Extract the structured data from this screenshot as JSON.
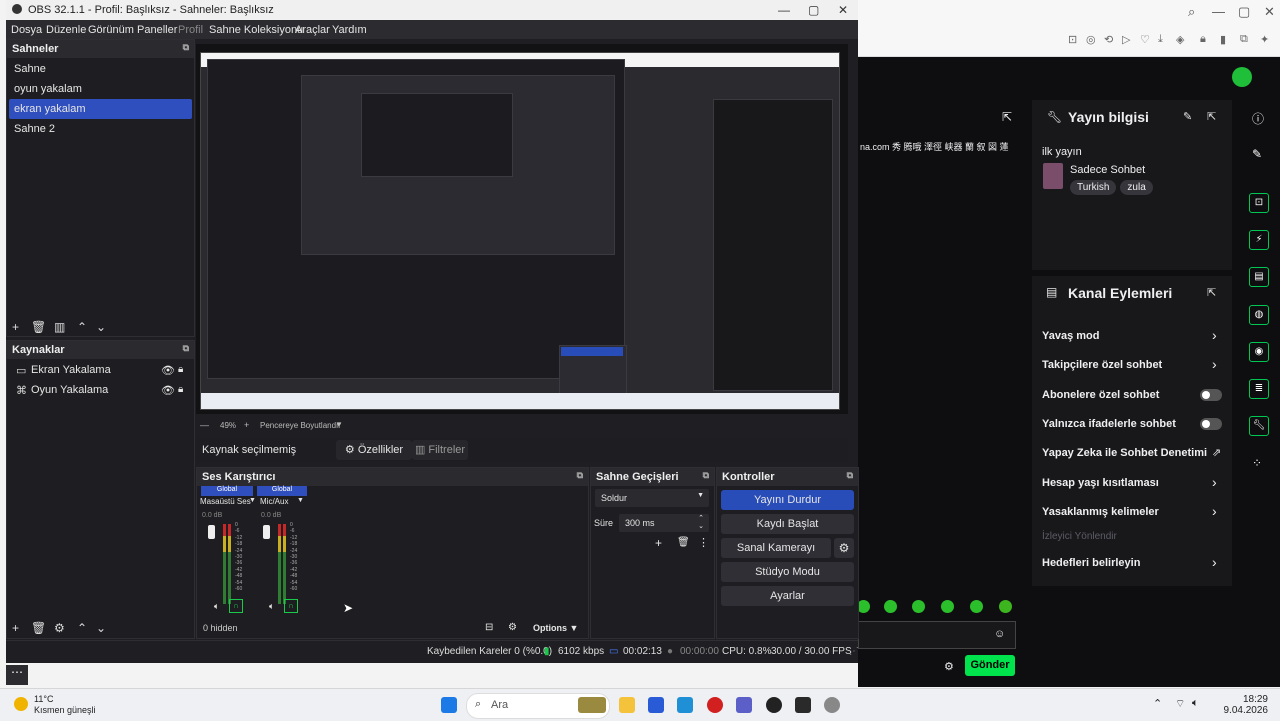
{
  "obs": {
    "title": "OBS 32.1.1 - Profil: Başlıksız - Sahneler: Başlıksız",
    "menu": [
      "Dosya",
      "Düzenle",
      "Görünüm",
      "Paneller",
      "Profil",
      "Sahne Koleksiyonu",
      "Araçlar",
      "Yardım"
    ],
    "scenes_header": "Sahneler",
    "scenes": [
      "Sahne",
      "oyun yakalam",
      "ekran yakalam",
      "Sahne 2"
    ],
    "selected_scene_index": 2,
    "sources_header": "Kaynaklar",
    "sources": [
      "Ekran Yakalama",
      "Oyun Yakalama"
    ],
    "preview_zoom": "49%",
    "preview_mode": "Pencereye Boyutlandır",
    "no_source_selected": "Kaynak seçilmemiş",
    "properties_button": "Özellikler",
    "filters_button": "Filtreler",
    "mixer_header": "Ses Karıştırıcı",
    "mixer_channels": [
      {
        "tag": "Global",
        "name": "Masaüstü Ses",
        "db": "0.0 dB"
      },
      {
        "tag": "Global",
        "name": "Mic/Aux",
        "db": "0.0 dB"
      }
    ],
    "meter_scale": [
      "0",
      "-6",
      "-12",
      "-18",
      "-24",
      "-30",
      "-36",
      "-42",
      "-48",
      "-54",
      "-60"
    ],
    "hidden_count": "0 hidden",
    "options_label": "Options",
    "transitions_header": "Sahne Geçişleri",
    "transition_value": "Soldur",
    "duration_label": "Süre",
    "duration_value": "300 ms",
    "controls_header": "Kontroller",
    "controls": [
      "Yayını Durdur",
      "Kaydı Başlat",
      "Sanal Kamerayı Başlat",
      "Stüdyo Modu",
      "Ayarlar"
    ],
    "status": {
      "dropped": "Kaybedilen Kareler 0 (%0.0)",
      "bitrate": "6102 kbps",
      "stream_time": "00:02:13",
      "rec_time": "00:00:00",
      "cpu": "CPU: 0.8%",
      "fps": "30.00 / 30.00 FPS"
    }
  },
  "twitch": {
    "chat_snippet": "na.com 秀 腾哦 澤徑 峡器 蘭 叙 図 蓮",
    "stream_info_title": "Yayın bilgisi",
    "stream_title": "ilk yayın",
    "category": "Sadece Sohbet",
    "tags": [
      "Turkish",
      "zula"
    ],
    "channel_actions_title": "Kanal Eylemleri",
    "actions": [
      {
        "label": "Yavaş mod",
        "kind": "chevron"
      },
      {
        "label": "Takipçilere özel sohbet",
        "kind": "chevron"
      },
      {
        "label": "Abonelere özel sohbet",
        "kind": "toggle"
      },
      {
        "label": "Yalnızca ifadelerle sohbet",
        "kind": "toggle"
      },
      {
        "label": "Yapay Zeka ile Sohbet Denetimi",
        "kind": "external"
      },
      {
        "label": "Hesap yaşı kısıtlaması",
        "kind": "chevron"
      },
      {
        "label": "Yasaklanmış kelimeler",
        "kind": "chevron"
      },
      {
        "label": "İzleyici Yönlendir",
        "kind": "disabled"
      },
      {
        "label": "Hedefleri belirleyin",
        "kind": "chevron"
      }
    ],
    "send_button": "Gönder",
    "accent": "#00e34d"
  },
  "taskbar": {
    "weather_temp": "11°C",
    "weather_desc": "Kısmen güneşli",
    "search_placeholder": "Ara",
    "time": "18:29",
    "date": "9.04.2026"
  }
}
